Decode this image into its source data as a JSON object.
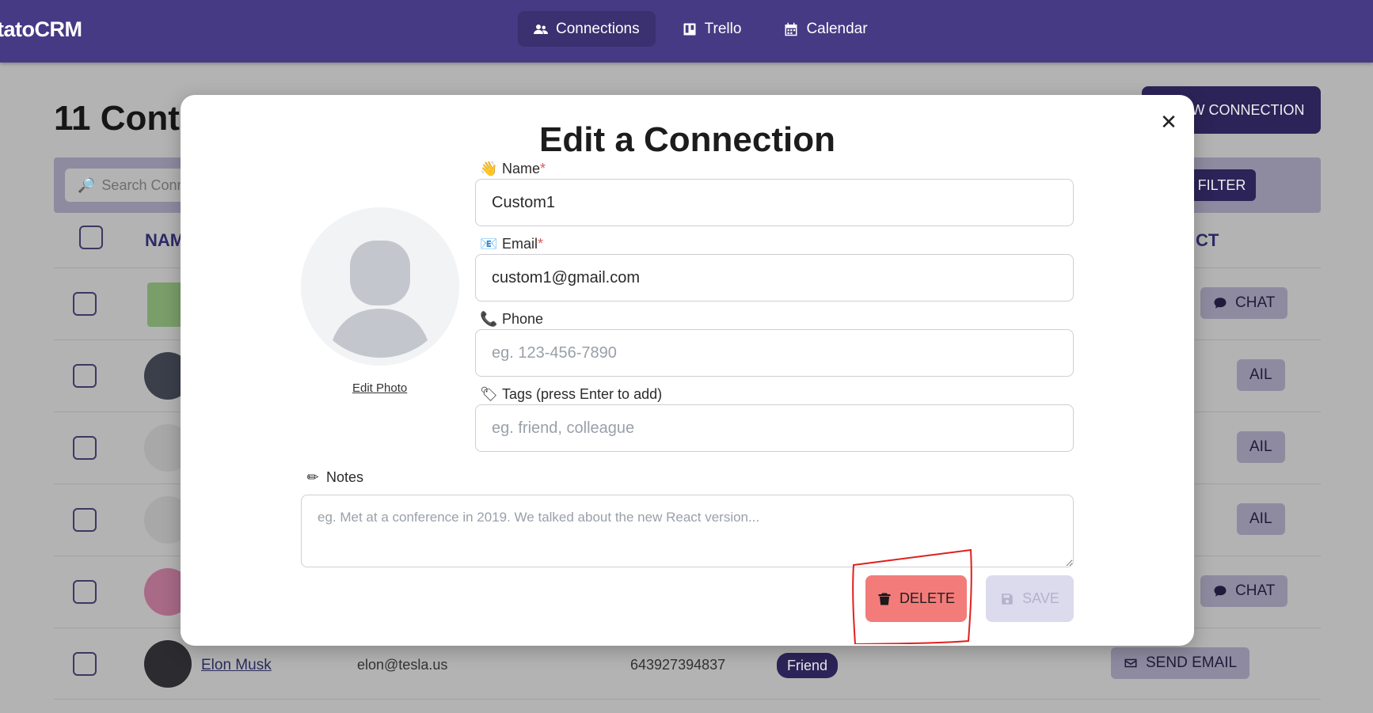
{
  "app": {
    "brand": "tatoCRM",
    "nav": [
      {
        "label": "Connections",
        "icon": "people-icon",
        "active": true
      },
      {
        "label": "Trello",
        "icon": "trello-icon",
        "active": false
      },
      {
        "label": "Calendar",
        "icon": "calendar-icon",
        "active": false
      }
    ]
  },
  "page": {
    "title": "11 Cont",
    "new_button": "EW CONNECTION",
    "search_placeholder": "Search Conn",
    "filter_label": "FILTER",
    "columns": {
      "name": "NAM",
      "contact": "CT"
    },
    "rows": [
      {
        "action": "CHAT",
        "action_icon": "chat-icon"
      },
      {
        "action": "AIL",
        "action_icon": "mail-icon"
      },
      {
        "action": "AIL",
        "action_icon": "mail-icon"
      },
      {
        "action": "AIL",
        "action_icon": "mail-icon"
      },
      {
        "action": "CHAT",
        "action_icon": "chat-icon"
      },
      {
        "name": "Elon Musk",
        "email": "elon@tesla.us",
        "phone": "643927394837",
        "tag": "Friend",
        "action": "SEND EMAIL",
        "action_icon": "mail-icon"
      }
    ]
  },
  "modal": {
    "title": "Edit a Connection",
    "edit_photo": "Edit Photo",
    "fields": {
      "name": {
        "label": "Name",
        "required": "*",
        "emoji": "👋",
        "value": "Custom1",
        "placeholder": ""
      },
      "email": {
        "label": "Email",
        "required": "*",
        "emoji": "📧",
        "value": "custom1@gmail.com",
        "placeholder": ""
      },
      "phone": {
        "label": "Phone",
        "emoji": "📞",
        "value": "",
        "placeholder": "eg. 123-456-7890"
      },
      "tags": {
        "label": "Tags (press Enter to add)",
        "emoji": "🏷",
        "value": "",
        "placeholder": "eg. friend, colleague"
      },
      "notes": {
        "label": "Notes",
        "emoji": "✏",
        "value": "",
        "placeholder": "eg. Met at a conference in 2019. We talked about the new React version..."
      }
    },
    "delete_label": "DELETE",
    "save_label": "SAVE"
  },
  "colors": {
    "nav_bg": "#463a84",
    "accent_dark": "#2c2458",
    "delete_bg": "#f37c7a",
    "save_disabled_bg": "#dcdbed",
    "annotation_red": "#e0201c"
  }
}
